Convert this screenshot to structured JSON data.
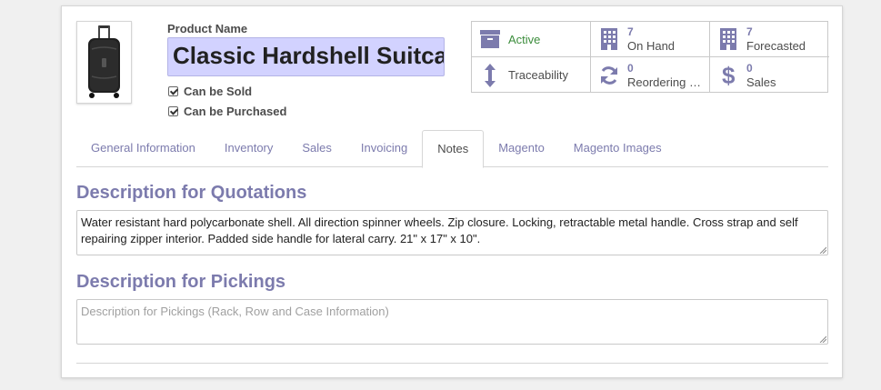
{
  "product": {
    "name_label": "Product Name",
    "name_value": "Classic Hardshell Suitcase",
    "can_be_sold_label": "Can be Sold",
    "can_be_sold_checked": true,
    "can_be_purchased_label": "Can be Purchased",
    "can_be_purchased_checked": true,
    "image_icon": "suitcase-image"
  },
  "smart_buttons": [
    {
      "icon": "archive-icon",
      "value": "",
      "label": "Active"
    },
    {
      "icon": "building-icon",
      "value": "7",
      "label": "On Hand"
    },
    {
      "icon": "building-icon",
      "value": "7",
      "label": "Forecasted"
    },
    {
      "icon": "arrows-v-icon",
      "value": "",
      "label": "Traceability"
    },
    {
      "icon": "refresh-icon",
      "value": "0",
      "label": "Reordering R…"
    },
    {
      "icon": "dollar-icon",
      "value": "0",
      "label": "Sales"
    }
  ],
  "tabs": [
    {
      "label": "General Information"
    },
    {
      "label": "Inventory"
    },
    {
      "label": "Sales"
    },
    {
      "label": "Invoicing"
    },
    {
      "label": "Notes",
      "active": true
    },
    {
      "label": "Magento"
    },
    {
      "label": "Magento Images"
    }
  ],
  "notes": {
    "quotations_title": "Description for Quotations",
    "quotations_value": "Water resistant hard polycarbonate shell. All direction spinner wheels. Zip closure. Locking, retractable metal handle. Cross strap and self repairing zipper interior. Padded side handle for lateral carry. 21\" x 17\" x 10\".",
    "pickings_title": "Description for Pickings",
    "pickings_value": "",
    "pickings_placeholder": "Description for Pickings (Rack, Row and Case Information)"
  },
  "colors": {
    "accent": "#7c7bad",
    "input_highlight": "#d2d2ff",
    "active_green": "#3c8d3c"
  }
}
